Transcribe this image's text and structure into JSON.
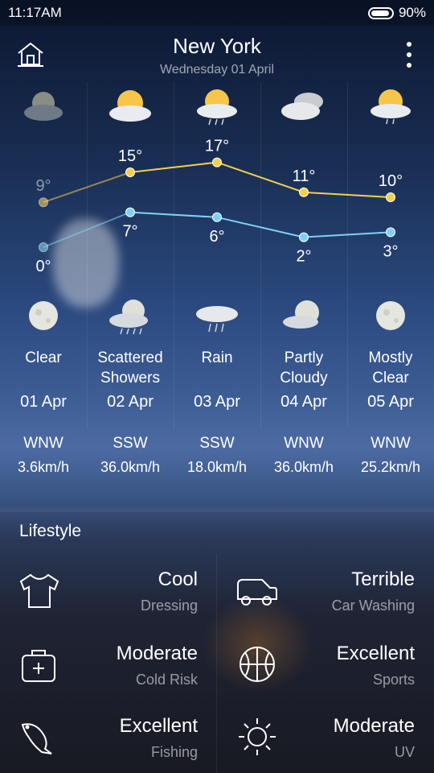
{
  "status_bar": {
    "time": "11:17AM",
    "battery_text": "90%",
    "battery_level": 0.9
  },
  "header": {
    "city": "New York",
    "date": "Wednesday 01 April"
  },
  "forecast": {
    "days": [
      {
        "condition_line1": "Clear",
        "condition_line2": "",
        "date": "01 Apr",
        "high": "9°",
        "low": "0°",
        "high_value": 9,
        "low_value": 0,
        "day_icon": "cloudy-sun-dim-icon",
        "night_icon": "moon-icon"
      },
      {
        "condition_line1": "Scattered",
        "condition_line2": "Showers",
        "date": "02 Apr",
        "high": "15°",
        "low": "7°",
        "high_value": 15,
        "low_value": 7,
        "day_icon": "partly-sunny-icon",
        "night_icon": "moon-cloud-rain-icon"
      },
      {
        "condition_line1": "Rain",
        "condition_line2": "",
        "date": "03 Apr",
        "high": "17°",
        "low": "6°",
        "high_value": 17,
        "low_value": 6,
        "day_icon": "sun-cloud-rain-icon",
        "night_icon": "cloud-rain-icon"
      },
      {
        "condition_line1": "Partly",
        "condition_line2": "Cloudy",
        "date": "04 Apr",
        "high": "11°",
        "low": "2°",
        "high_value": 11,
        "low_value": 2,
        "day_icon": "cloudy-icon",
        "night_icon": "moon-cloud-icon"
      },
      {
        "condition_line1": "Mostly",
        "condition_line2": "Clear",
        "date": "05 Apr",
        "high": "10°",
        "low": "3°",
        "high_value": 10,
        "low_value": 3,
        "day_icon": "sun-cloud-drizzle-icon",
        "night_icon": "moon-icon"
      }
    ],
    "high_color": "#f5cf4a",
    "low_color": "#7fd0f5"
  },
  "wind": [
    {
      "direction": "WNW",
      "speed": "3.6km/h"
    },
    {
      "direction": "SSW",
      "speed": "36.0km/h"
    },
    {
      "direction": "SSW",
      "speed": "18.0km/h"
    },
    {
      "direction": "WNW",
      "speed": "36.0km/h"
    },
    {
      "direction": "WNW",
      "speed": "25.2km/h"
    }
  ],
  "lifestyle": {
    "title": "Lifestyle",
    "items": [
      {
        "value": "Cool",
        "label": "Dressing",
        "icon": "shirt-icon"
      },
      {
        "value": "Terrible",
        "label": "Car Washing",
        "icon": "car-icon"
      },
      {
        "value": "Moderate",
        "label": "Cold Risk",
        "icon": "medical-kit-icon"
      },
      {
        "value": "Excellent",
        "label": "Sports",
        "icon": "basketball-icon"
      },
      {
        "value": "Excellent",
        "label": "Fishing",
        "icon": "fish-icon"
      },
      {
        "value": "Moderate",
        "label": "UV",
        "icon": "sun-uv-icon"
      }
    ]
  }
}
